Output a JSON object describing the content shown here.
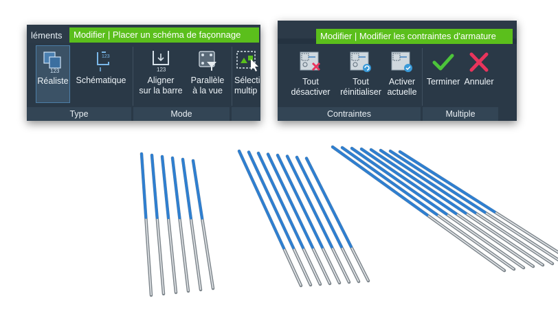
{
  "left_panel": {
    "tabs": [
      {
        "label": "léments"
      },
      {
        "label": "Modifier | Placer un schéma de façonnage",
        "active": true
      }
    ],
    "tools": [
      {
        "label_1": "Réaliste",
        "label_2": "",
        "icon": "realistic-view-icon",
        "selected": true
      },
      {
        "label_1": "Schématique",
        "label_2": "",
        "icon": "schematic-view-icon"
      },
      {
        "label_1": "Aligner",
        "label_2": "sur la barre",
        "icon": "align-to-bar-icon"
      },
      {
        "label_1": "Parallèle",
        "label_2": "à la vue",
        "icon": "parallel-to-view-icon"
      },
      {
        "label_1": "Sélecti",
        "label_2": "multip",
        "icon": "multi-select-icon"
      }
    ],
    "groups": [
      {
        "label": "Type"
      },
      {
        "label": "Mode"
      }
    ]
  },
  "right_panel": {
    "tab": {
      "label": "Modifier | Modifier les contraintes d'armature"
    },
    "tools": [
      {
        "label_1": "Tout",
        "label_2": "désactiver",
        "icon": "disable-all-constraints-icon"
      },
      {
        "label_1": "Tout",
        "label_2": "réinitialiser",
        "icon": "reset-all-constraints-icon"
      },
      {
        "label_1": "Activer",
        "label_2": "actuelle",
        "icon": "activate-current-constraint-icon"
      },
      {
        "label_1": "Terminer",
        "label_2": "",
        "icon": "check-icon"
      },
      {
        "label_1": "Annuler",
        "label_2": "",
        "icon": "cancel-x-icon"
      }
    ],
    "groups": [
      {
        "label": "Contraintes"
      },
      {
        "label": "Multiple"
      }
    ]
  },
  "colors": {
    "accent_green": "#5bbf1c",
    "ribbon_bg": "#2a3947",
    "highlight_blue": "#2f7fd0",
    "bar_grey": "#8e969c",
    "check_green": "#4cc43a",
    "cancel_pink": "#e8345c"
  }
}
